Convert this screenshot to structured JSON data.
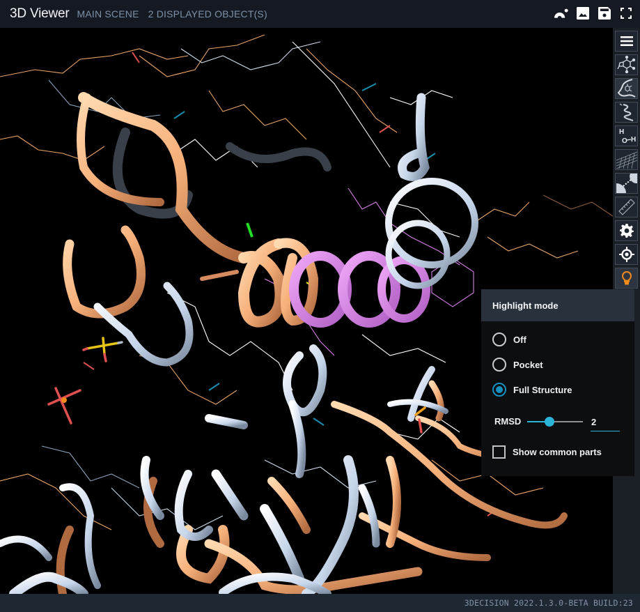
{
  "header": {
    "title": "3D Viewer",
    "breadcrumbs": [
      "MAIN SCENE",
      "2 DISPLAYED OBJECT(S)"
    ],
    "actions": [
      {
        "name": "surface-icon",
        "label": "Surface"
      },
      {
        "name": "image-icon",
        "label": "Screenshot"
      },
      {
        "name": "save-icon",
        "label": "Save"
      },
      {
        "name": "fullscreen-icon",
        "label": "Fullscreen"
      }
    ]
  },
  "toolbar": {
    "items": [
      {
        "name": "menu-icon",
        "label": "Menu"
      },
      {
        "name": "ligand-icon",
        "label": "Ligand"
      },
      {
        "name": "pocket-ligand-icon",
        "label": "Pocket"
      },
      {
        "name": "helix-icon",
        "label": "Cartoon"
      },
      {
        "name": "water-icon",
        "label": "Water",
        "text": "H O–H"
      },
      {
        "name": "mesh-icon",
        "label": "Surface mesh"
      },
      {
        "name": "distance-icon",
        "label": "Distance"
      },
      {
        "name": "ruler-icon",
        "label": "Measure"
      },
      {
        "name": "gear-icon",
        "label": "Settings"
      },
      {
        "name": "target-icon",
        "label": "Center"
      },
      {
        "name": "lightbulb-icon",
        "label": "Highlight mode",
        "active": true
      }
    ]
  },
  "highlight_panel": {
    "title": "Highlight mode",
    "options": [
      {
        "label": "Off",
        "selected": false
      },
      {
        "label": "Pocket",
        "selected": false
      },
      {
        "label": "Full Structure",
        "selected": true
      }
    ],
    "rmsd": {
      "label": "RMSD",
      "value": "2",
      "slider_fraction": 0.4
    },
    "show_common_parts": {
      "label": "Show common parts",
      "checked": false
    }
  },
  "colors": {
    "accent": "#2ab4d8",
    "radio_on": "#1591c0",
    "highlight_active": "#f08a1c",
    "structure_a": "#ffc08a",
    "structure_b": "#d4e2f5",
    "highlighted_region": "#d77ee6"
  },
  "footer": {
    "version": "3DECISION 2022.1.3.0-BETA BUILD:23"
  }
}
